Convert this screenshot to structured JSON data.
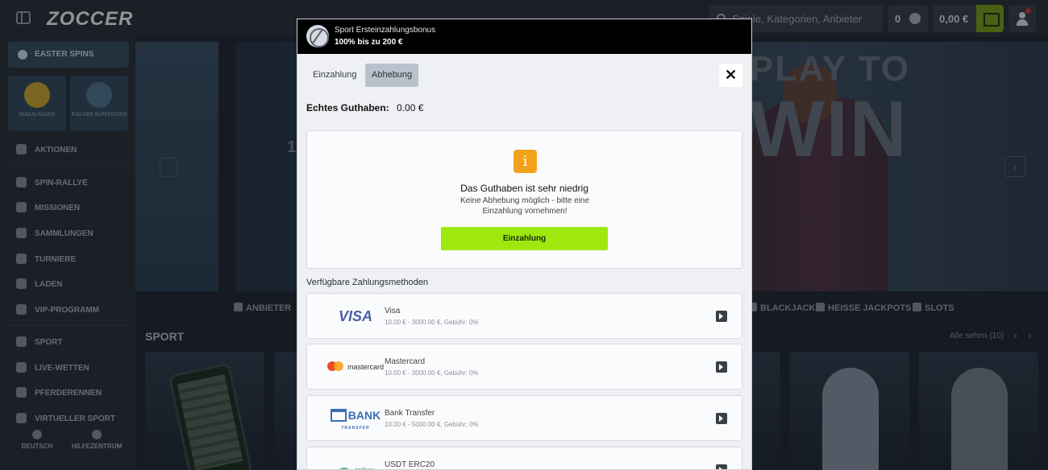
{
  "header": {
    "logo": "ZOCCER",
    "search_placeholder": "Spiele, Kategorien, Anbieter",
    "coins": "0",
    "balance": "0,00 €"
  },
  "sidebar": {
    "easter": "EASTER SPINS",
    "tiles": [
      {
        "label": "BONUS-RÄDER"
      },
      {
        "label": "RAD DER SUPERSTARS"
      }
    ],
    "items": [
      {
        "label": "AKTIONEN"
      },
      {
        "label": "SPIN-RALLYE"
      },
      {
        "label": "MISSIONEN"
      },
      {
        "label": "SAMMLUNGEN"
      },
      {
        "label": "TURNIERE"
      },
      {
        "label": "LADEN"
      },
      {
        "label": "VIP-PROGRAMM"
      },
      {
        "label": "SPORT"
      },
      {
        "label": "LIVE-WETTEN"
      },
      {
        "label": "PFERDERENNEN"
      },
      {
        "label": "VIRTUELLER SPORT"
      }
    ],
    "footer": {
      "language": "DEUTSCH",
      "help": "HILFEZENTRUM"
    }
  },
  "main": {
    "hero_text_1": "PLAY TO",
    "hero_text_2": "WIN",
    "hero_num": "1",
    "categories": [
      "ANBIETER",
      "BLACKJACK",
      "HEISSE JACKPOTS",
      "SLOTS"
    ],
    "section_title": "SPORT",
    "see_all": "Alle sehen (10)",
    "pager_prev": "‹",
    "pager_next": "›"
  },
  "modal": {
    "promo_subtitle": "Sport Ersteinzahlungsbonus",
    "promo_title": "100% bis zu 200 €",
    "tabs": [
      {
        "label": "Einzahlung",
        "active": false
      },
      {
        "label": "Abhebung",
        "active": true
      }
    ],
    "close": "✕",
    "balance_label": "Echtes Guthaben:",
    "balance_value": "0.00 €",
    "notice": {
      "icon": "i",
      "title": "Das Guthaben ist sehr niedrig",
      "text": "Keine Abhebung möglich - bitte eine Einzahlung vornehmen!",
      "button": "Einzahlung"
    },
    "methods_label": "Verfügbare Zahlungsmethoden",
    "methods": [
      {
        "logo": "VISA",
        "name": "Visa",
        "limit": "10.00 € - 3000.00 €, Gebühr: 0%"
      },
      {
        "logo": "mastercard",
        "name": "Mastercard",
        "limit": "10.00 € - 3000.00 €, Gebühr: 0%"
      },
      {
        "logo": "BANK",
        "logo_sub": "TRANSFER",
        "name": "Bank Transfer",
        "limit": "10.00 € - 5000.00 €, Gebühr: 0%"
      },
      {
        "logo": "tether",
        "name": "USDT ERC20",
        "limit": ""
      }
    ]
  },
  "colors": {
    "accent": "#9ee80f",
    "info": "#f2a31c",
    "promo_bg": "#000000",
    "active_tab": "#b9c2cc"
  }
}
